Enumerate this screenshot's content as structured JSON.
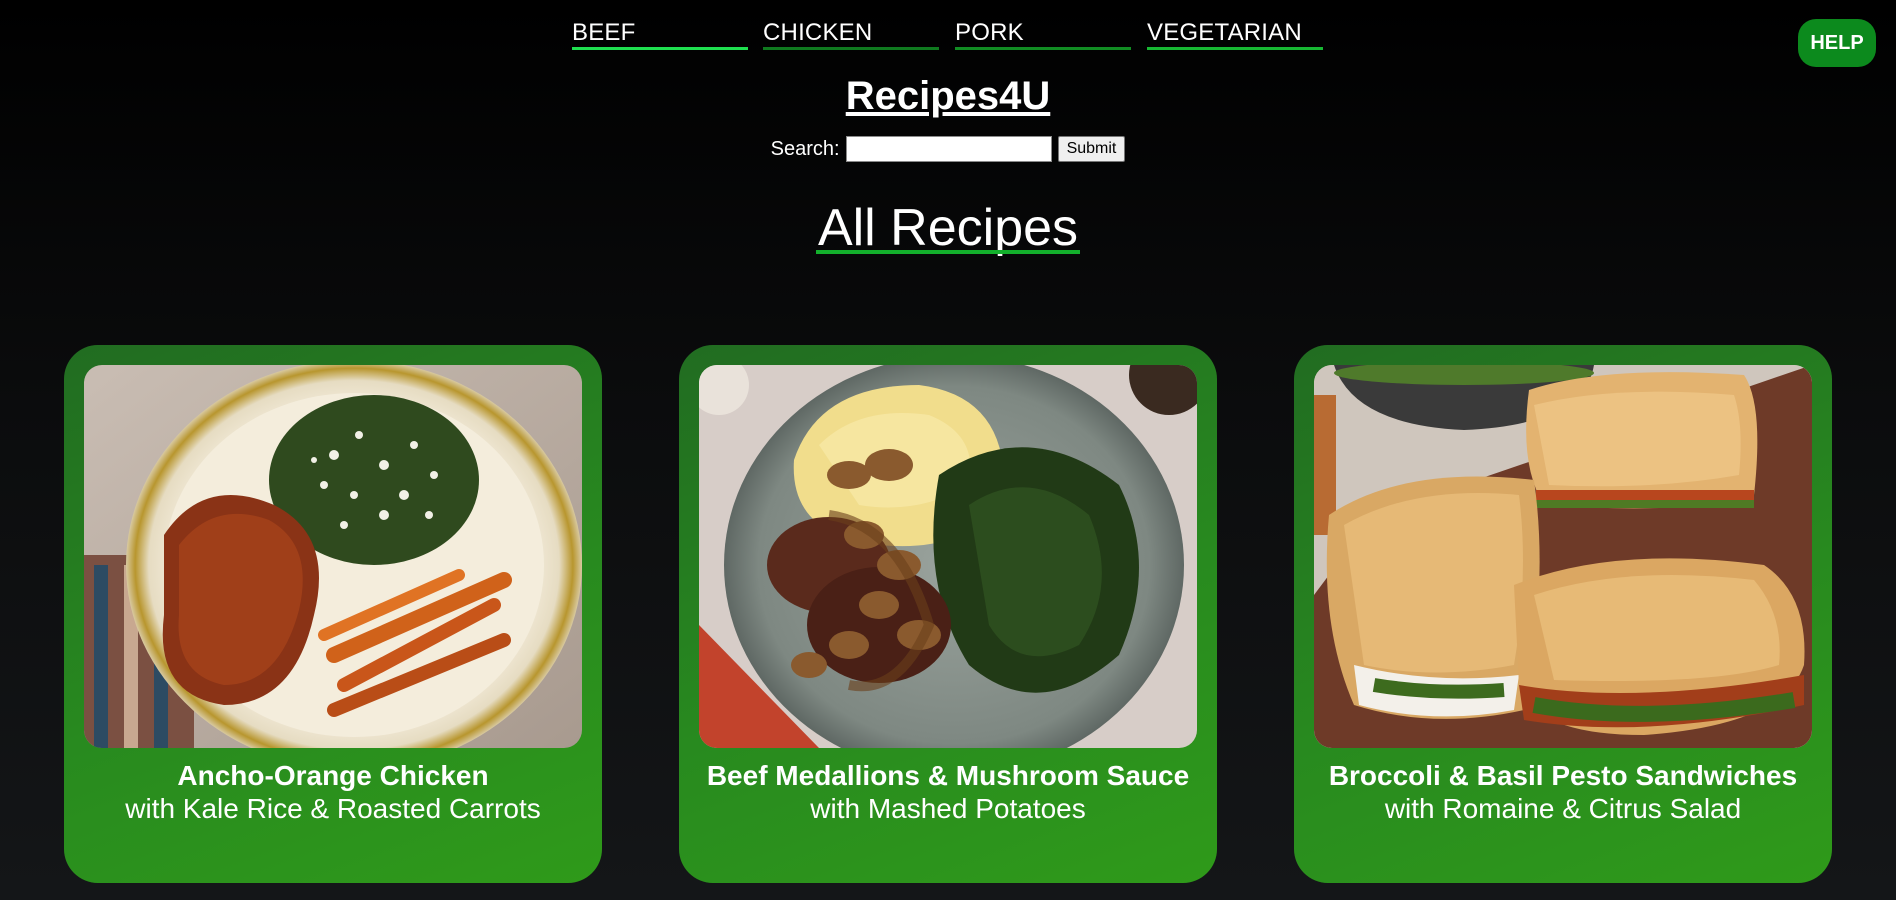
{
  "nav": {
    "tabs": [
      {
        "label": "BEEF"
      },
      {
        "label": "CHICKEN"
      },
      {
        "label": "PORK"
      },
      {
        "label": "VEGETARIAN"
      }
    ]
  },
  "help": {
    "label": "HELP"
  },
  "site": {
    "title": "Recipes4U"
  },
  "search": {
    "label": "Search:",
    "value": "",
    "placeholder": "",
    "submit_label": "Submit"
  },
  "section": {
    "heading": "All Recipes"
  },
  "recipes": [
    {
      "title": "Ancho-Orange Chicken",
      "subtitle": "with Kale Rice & Roasted Carrots",
      "image": "ancho-orange-chicken-photo"
    },
    {
      "title": "Beef Medallions & Mushroom Sauce",
      "subtitle": "with Mashed Potatoes",
      "image": "beef-medallions-photo"
    },
    {
      "title": "Broccoli & Basil Pesto Sandwiches",
      "subtitle": "with Romaine & Citrus Salad",
      "image": "pesto-sandwiches-photo"
    }
  ],
  "colors": {
    "accent": "#0c8a1d",
    "card_bg": "#288a1f",
    "background": "#0b0c0d"
  }
}
